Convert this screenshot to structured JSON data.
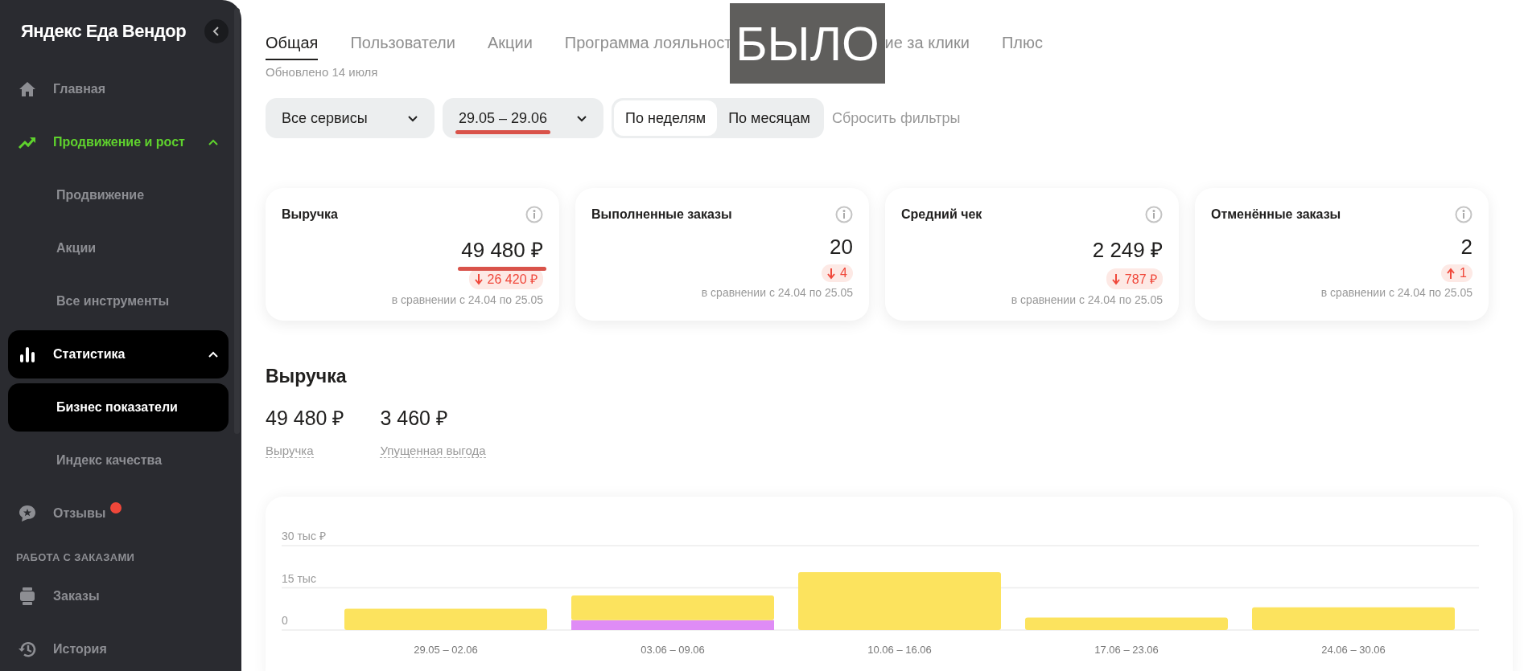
{
  "sidebar": {
    "logo": "Яндекс Еда Вендор",
    "items": [
      {
        "kind": "item",
        "label": "Главная",
        "selected": false,
        "highlighted": false,
        "unread": false
      },
      {
        "kind": "group",
        "label": "Продвижение и рост",
        "selected": false,
        "highlighted": true,
        "unread": false,
        "expanded": true,
        "children": [
          {
            "label": "Продвижение",
            "selected": false
          },
          {
            "label": "Акции",
            "selected": false
          },
          {
            "label": "Все инструменты",
            "selected": false
          }
        ]
      },
      {
        "kind": "group",
        "label": "Статистика",
        "selected": true,
        "highlighted": false,
        "unread": false,
        "expanded": true,
        "children": [
          {
            "label": "Бизнес показатели",
            "selected": true
          },
          {
            "label": "Индекс качества",
            "selected": false
          }
        ]
      },
      {
        "kind": "item",
        "label": "Отзывы",
        "selected": false,
        "highlighted": false,
        "unread": true
      },
      {
        "kind": "heading",
        "label": "РАБОТА С ЗАКАЗАМИ"
      },
      {
        "kind": "item",
        "label": "Заказы",
        "selected": false,
        "highlighted": false,
        "unread": false
      },
      {
        "kind": "item",
        "label": "История",
        "selected": false,
        "highlighted": false,
        "unread": false
      }
    ]
  },
  "overlay_label": "БЫЛО",
  "tabs": [
    {
      "label": "Общая",
      "selected": true
    },
    {
      "label": "Пользователи",
      "selected": false
    },
    {
      "label": "Акции",
      "selected": false
    },
    {
      "label": "Программа лояльност",
      "selected": false
    },
    {
      "label": "ие за клики",
      "selected": false
    },
    {
      "label": "Плюс",
      "selected": false
    }
  ],
  "updated": "Обновлено 14 июля",
  "filters": {
    "service": "Все сервисы",
    "period": "29.05 – 29.06",
    "grouping": [
      {
        "label": "По неделям",
        "selected": true
      },
      {
        "label": "По месяцам",
        "selected": false
      }
    ],
    "reset": "Сбросить фильтры"
  },
  "cards": [
    {
      "title": "Выручка",
      "value": "49 480 ₽",
      "change": "26 420 ₽",
      "rising": false,
      "note": "в сравнении с 24.04 по 25.05",
      "marked": true
    },
    {
      "title": "Выполненные заказы",
      "value": "20",
      "change": "4",
      "rising": false,
      "note": "в сравнении с 24.04 по 25.05",
      "marked": false
    },
    {
      "title": "Средний чек",
      "value": "2 249 ₽",
      "change": "787 ₽",
      "rising": false,
      "note": "в сравнении с 24.04 по 25.05",
      "marked": false
    },
    {
      "title": "Отменённые заказы",
      "value": "2",
      "change": "1",
      "rising": true,
      "note": "в сравнении с 24.04 по 25.05",
      "marked": false
    }
  ],
  "revenue": {
    "title": "Выручка",
    "totals": [
      {
        "value": "49 480 ₽",
        "label": "Выручка"
      },
      {
        "value": "3 460 ₽",
        "label": "Упущенная выгода"
      }
    ],
    "chart_data": {
      "type": "bar",
      "stacked": true,
      "categories": [
        "29.05 – 02.06",
        "03.06 – 09.06",
        "10.06 – 16.06",
        "17.06 – 23.06",
        "24.06 – 30.06"
      ],
      "series": [
        {
          "color": "#df8cf6",
          "values": [
            0,
            3.5,
            0,
            0,
            0
          ]
        },
        {
          "color": "#fce35e",
          "values": [
            7.6,
            8.8,
            20.6,
            4.4,
            8.1
          ]
        }
      ],
      "ylim": [
        0,
        30
      ],
      "yticks": [
        {
          "value": 0,
          "label": "0"
        },
        {
          "value": 15,
          "label": "15 тыс"
        },
        {
          "value": 30,
          "label": "30 тыс ₽"
        }
      ]
    }
  }
}
